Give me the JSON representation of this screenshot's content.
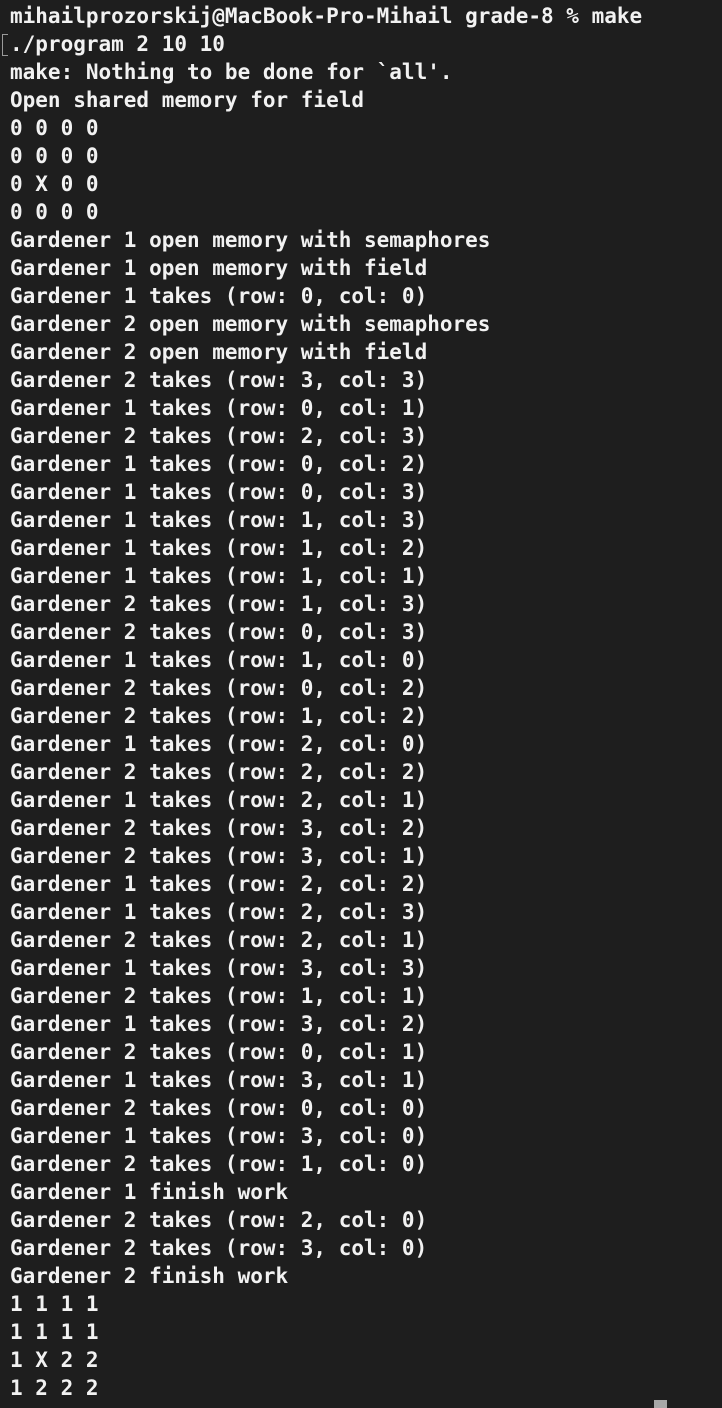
{
  "terminal": {
    "lines": [
      "mihailprozorskij@MacBook-Pro-Mihail grade-8 % make",
      "./program 2 10 10",
      "make: Nothing to be done for `all'.",
      "Open shared memory for field",
      "0 0 0 0",
      "0 0 0 0",
      "0 X 0 0",
      "0 0 0 0",
      "Gardener 1 open memory with semaphores",
      "Gardener 1 open memory with field",
      "Gardener 1 takes (row: 0, col: 0)",
      "Gardener 2 open memory with semaphores",
      "Gardener 2 open memory with field",
      "Gardener 2 takes (row: 3, col: 3)",
      "Gardener 1 takes (row: 0, col: 1)",
      "Gardener 2 takes (row: 2, col: 3)",
      "Gardener 1 takes (row: 0, col: 2)",
      "Gardener 1 takes (row: 0, col: 3)",
      "Gardener 1 takes (row: 1, col: 3)",
      "Gardener 1 takes (row: 1, col: 2)",
      "Gardener 1 takes (row: 1, col: 1)",
      "Gardener 2 takes (row: 1, col: 3)",
      "Gardener 2 takes (row: 0, col: 3)",
      "Gardener 1 takes (row: 1, col: 0)",
      "Gardener 2 takes (row: 0, col: 2)",
      "Gardener 2 takes (row: 1, col: 2)",
      "Gardener 1 takes (row: 2, col: 0)",
      "Gardener 2 takes (row: 2, col: 2)",
      "Gardener 1 takes (row: 2, col: 1)",
      "Gardener 2 takes (row: 3, col: 2)",
      "Gardener 2 takes (row: 3, col: 1)",
      "Gardener 1 takes (row: 2, col: 2)",
      "Gardener 1 takes (row: 2, col: 3)",
      "Gardener 2 takes (row: 2, col: 1)",
      "Gardener 1 takes (row: 3, col: 3)",
      "Gardener 2 takes (row: 1, col: 1)",
      "Gardener 1 takes (row: 3, col: 2)",
      "Gardener 2 takes (row: 0, col: 1)",
      "Gardener 1 takes (row: 3, col: 1)",
      "Gardener 2 takes (row: 0, col: 0)",
      "Gardener 1 takes (row: 3, col: 0)",
      "Gardener 2 takes (row: 1, col: 0)",
      "Gardener 1 finish work",
      "Gardener 2 takes (row: 2, col: 0)",
      "Gardener 2 takes (row: 3, col: 0)",
      "Gardener 2 finish work",
      "1 1 1 1",
      "1 1 1 1",
      "1 X 2 2",
      "1 2 2 2"
    ],
    "colors": {
      "background": "#1e1e1e",
      "text": "#f2f2f2",
      "cursor": "#a8a8a8"
    }
  }
}
